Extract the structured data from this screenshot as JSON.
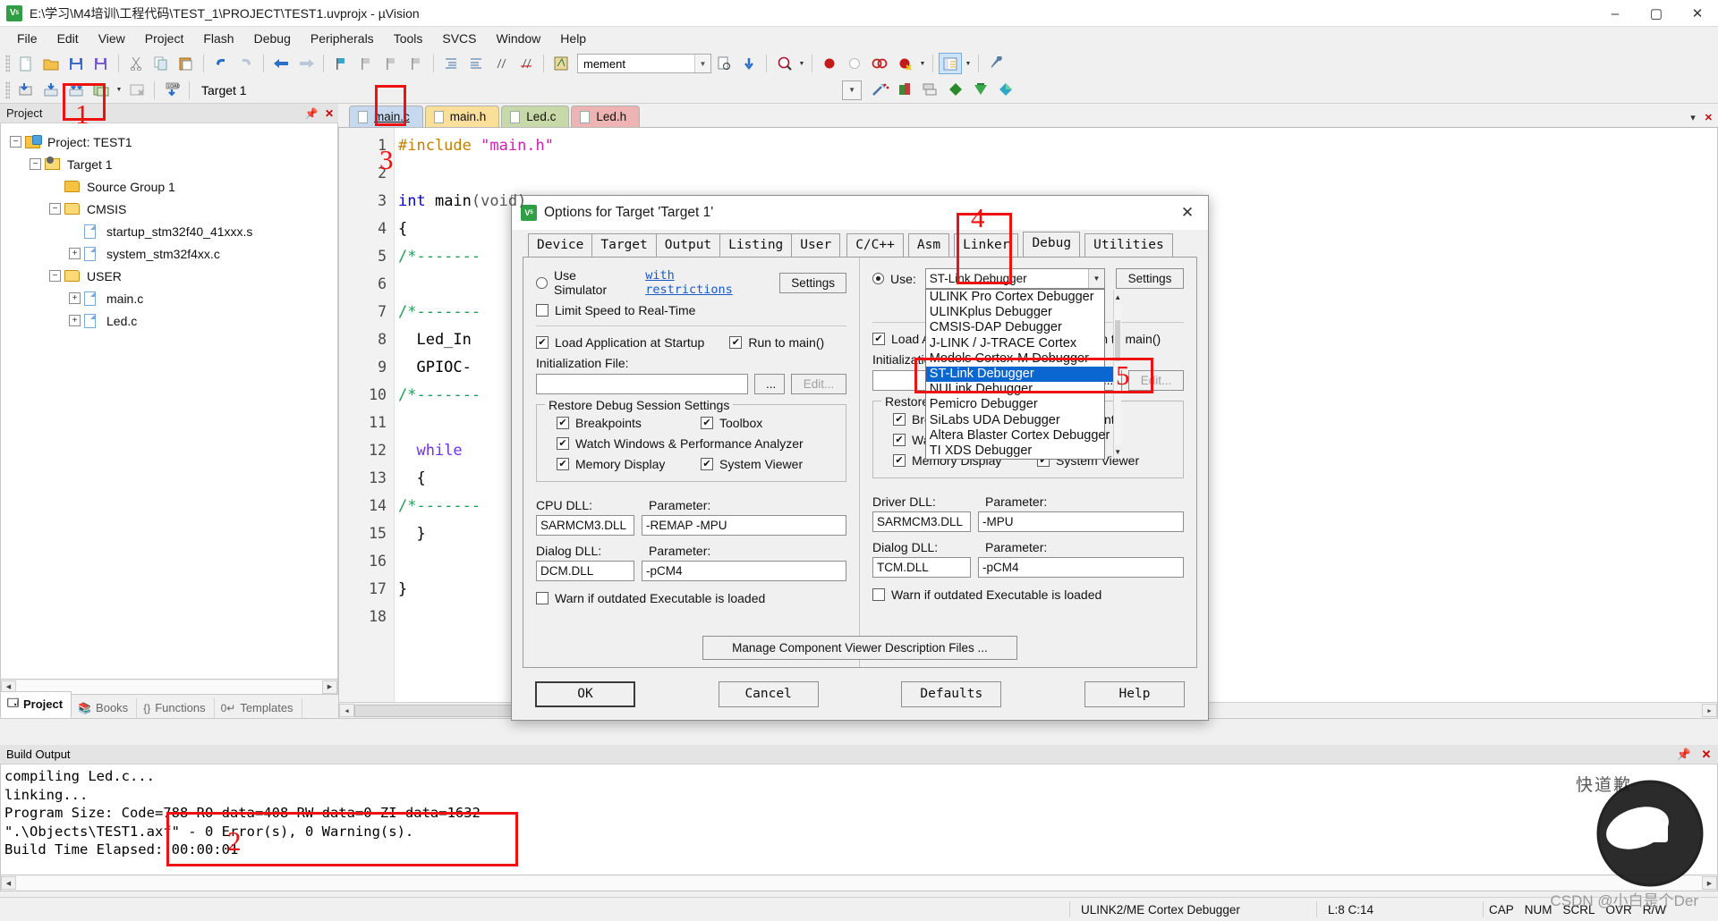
{
  "window": {
    "title": "E:\\学习\\M4培训\\工程代码\\TEST_1\\PROJECT\\TEST1.uvprojx - µVision",
    "app_icon": "uvision-icon",
    "minimize": "–",
    "maximize": "▢",
    "close": "✕"
  },
  "menubar": {
    "items": [
      "File",
      "Edit",
      "View",
      "Project",
      "Flash",
      "Debug",
      "Peripherals",
      "Tools",
      "SVCS",
      "Window",
      "Help"
    ]
  },
  "toolbar2": {
    "target_label": "Target 1",
    "combo_value": "mement"
  },
  "project": {
    "pane_title": "Project",
    "tabs": [
      {
        "label": "Project",
        "icon": "project-icon",
        "selected": true
      },
      {
        "label": "Books",
        "icon": "books-icon",
        "selected": false
      },
      {
        "label": "Functions",
        "icon": "functions-icon",
        "selected": false
      },
      {
        "label": "Templates",
        "icon": "templates-icon",
        "selected": false
      }
    ],
    "tree": [
      {
        "label": "Project: TEST1",
        "depth": 0,
        "expander": "−",
        "icon": "project-icon"
      },
      {
        "label": "Target 1",
        "depth": 1,
        "expander": "−",
        "icon": "target-icon"
      },
      {
        "label": "Source Group 1",
        "depth": 2,
        "expander": "",
        "icon": "folder-icon"
      },
      {
        "label": "CMSIS",
        "depth": 2,
        "expander": "−",
        "icon": "folder-icon"
      },
      {
        "label": "startup_stm32f40_41xxx.s",
        "depth": 3,
        "expander": "",
        "icon": "file-icon"
      },
      {
        "label": "system_stm32f4xx.c",
        "depth": 3,
        "expander": "+",
        "icon": "file-icon"
      },
      {
        "label": "USER",
        "depth": 2,
        "expander": "−",
        "icon": "folder-icon"
      },
      {
        "label": "main.c",
        "depth": 3,
        "expander": "+",
        "icon": "file-icon"
      },
      {
        "label": "Led.c",
        "depth": 3,
        "expander": "+",
        "icon": "file-icon"
      }
    ]
  },
  "editor": {
    "tabs": [
      {
        "label": "main.c",
        "selected": true,
        "color": "#c6d9ef"
      },
      {
        "label": "main.h",
        "selected": false,
        "color": "#fadf9a"
      },
      {
        "label": "Led.c",
        "selected": false,
        "color": "#c7d9a8"
      },
      {
        "label": "Led.h",
        "selected": false,
        "color": "#eeb4b4"
      }
    ],
    "lines": [
      {
        "no": "1",
        "segments": [
          {
            "t": "#include ",
            "c": "pre"
          },
          {
            "t": "\"main.h\"",
            "c": "str"
          }
        ]
      },
      {
        "no": "2",
        "segments": []
      },
      {
        "no": "3",
        "segments": [
          {
            "t": "int ",
            "c": "kw"
          },
          {
            "t": "main",
            "c": "plain"
          },
          {
            "t": "(void)",
            "c": "plain"
          }
        ]
      },
      {
        "no": "4",
        "segments": [
          {
            "t": "{",
            "c": "plain"
          }
        ]
      },
      {
        "no": "5",
        "segments": [
          {
            "t": "/*-------",
            "c": "cmt"
          }
        ]
      },
      {
        "no": "6",
        "segments": []
      },
      {
        "no": "7",
        "segments": [
          {
            "t": "/*-------",
            "c": "cmt"
          }
        ]
      },
      {
        "no": "8",
        "segments": [
          {
            "t": "  Led_In",
            "c": "plain"
          }
        ]
      },
      {
        "no": "9",
        "segments": [
          {
            "t": "  GPIOC-",
            "c": "plain"
          }
        ]
      },
      {
        "no": "10",
        "segments": [
          {
            "t": "/*-------",
            "c": "cmt"
          }
        ]
      },
      {
        "no": "11",
        "segments": []
      },
      {
        "no": "12",
        "segments": [
          {
            "t": "  while",
            "c": "kw2"
          }
        ]
      },
      {
        "no": "13",
        "segments": [
          {
            "t": "  {",
            "c": "plain"
          }
        ]
      },
      {
        "no": "14",
        "segments": [
          {
            "t": "/*-------",
            "c": "cmt"
          }
        ]
      },
      {
        "no": "15",
        "segments": [
          {
            "t": "  }",
            "c": "plain"
          }
        ]
      },
      {
        "no": "16",
        "segments": []
      },
      {
        "no": "17",
        "segments": [
          {
            "t": "}",
            "c": "plain"
          }
        ]
      },
      {
        "no": "18",
        "segments": []
      }
    ]
  },
  "build_output": {
    "title": "Build Output",
    "lines": [
      "compiling Led.c...",
      "linking...",
      "Program Size: Code=788 RO-data=408 RW-data=0 ZI-data=1632",
      "\".\\Objects\\TEST1.axf\" - 0 Error(s), 0 Warning(s).",
      "Build Time Elapsed:  00:00:01"
    ]
  },
  "statusbar": {
    "debugger": "ULINK2/ME Cortex Debugger",
    "cursor": "L:8 C:14",
    "indicators": [
      "CAP",
      "NUM",
      "SCRL",
      "OVR",
      "R/W"
    ]
  },
  "dialog": {
    "title": "Options for Target 'Target 1'",
    "close": "✕",
    "tabs": [
      {
        "label": "Device",
        "selected": false
      },
      {
        "label": "Target",
        "selected": false
      },
      {
        "label": "Output",
        "selected": false
      },
      {
        "label": "Listing",
        "selected": false
      },
      {
        "label": "User",
        "selected": false
      },
      {
        "label": "C/C++",
        "selected": false
      },
      {
        "label": "Asm",
        "selected": false
      },
      {
        "label": "Linker",
        "selected": false
      },
      {
        "label": "Debug",
        "selected": true
      },
      {
        "label": "Utilities",
        "selected": false
      }
    ],
    "left": {
      "use_simulator": "Use Simulator",
      "use_simulator_checked": false,
      "with_restrictions": "with restrictions",
      "settings_button": "Settings",
      "limit_speed": "Limit Speed to Real-Time",
      "limit_speed_checked": false,
      "load_app": "Load Application at Startup",
      "load_app_checked": true,
      "run_to_main": "Run to main()",
      "run_to_main_checked": true,
      "init_file_label": "Initialization File:",
      "init_file_value": "",
      "browse_button": "...",
      "edit_button": "Edit...",
      "restore_group": "Restore Debug Session Settings",
      "restore_items": [
        {
          "label": "Breakpoints",
          "checked": true
        },
        {
          "label": "Toolbox",
          "checked": true
        },
        {
          "label": "Watch Windows & Performance Analyzer",
          "checked": true
        },
        {
          "label": "Memory Display",
          "checked": true
        },
        {
          "label": "System Viewer",
          "checked": true
        }
      ],
      "cpu_dll_label": "CPU DLL:",
      "cpu_dll_value": "SARMCM3.DLL",
      "cpu_param_label": "Parameter:",
      "cpu_param_value": "-REMAP -MPU",
      "dialog_dll_label": "Dialog DLL:",
      "dialog_dll_value": "DCM.DLL",
      "dialog_param_label": "Parameter:",
      "dialog_param_value": "-pCM4",
      "warn_outdated": "Warn if outdated Executable is loaded",
      "warn_outdated_checked": false
    },
    "right": {
      "use_label": "Use:",
      "use_checked": true,
      "selected_debugger": "ST-Link Debugger",
      "settings_button": "Settings",
      "debugger_options": [
        "ULINK Pro Cortex Debugger",
        "ULINKplus Debugger",
        "CMSIS-DAP Debugger",
        "J-LINK / J-TRACE Cortex",
        "Models Cortex-M Debugger",
        "ST-Link Debugger",
        "NULink Debugger",
        "Pemicro Debugger",
        "SiLabs UDA Debugger",
        "Altera Blaster Cortex Debugger",
        "TI XDS Debugger"
      ],
      "selected_option_index": 5,
      "load_app": "Load Application at Startup",
      "load_app_checked": true,
      "run_to_main": "Run to main()",
      "run_to_main_checked": true,
      "init_file_label": "Initialization File:",
      "init_file_value": "",
      "browse_button": "...",
      "edit_button": "Edit...",
      "restore_group": "Restore Debug Session Settings",
      "restore_items": [
        {
          "label": "Breakpoints",
          "checked": true
        },
        {
          "label": "Tracepoints",
          "checked": true
        },
        {
          "label": "Watch Windows",
          "checked": true
        },
        {
          "label": "Memory Display",
          "checked": true
        },
        {
          "label": "System Viewer",
          "checked": true
        }
      ],
      "driver_dll_label": "Driver DLL:",
      "driver_dll_value": "SARMCM3.DLL",
      "driver_param_label": "Parameter:",
      "driver_param_value": "-MPU",
      "dialog_dll_label": "Dialog DLL:",
      "dialog_dll_value": "TCM.DLL",
      "dialog_param_label": "Parameter:",
      "dialog_param_value": "-pCM4",
      "warn_outdated": "Warn if outdated Executable is loaded",
      "warn_outdated_checked": false
    },
    "manage_button": "Manage Component Viewer Description Files ...",
    "buttons": {
      "ok": "OK",
      "cancel": "Cancel",
      "defaults": "Defaults",
      "help": "Help"
    }
  },
  "annotations": {
    "marks": [
      "1",
      "2",
      "3",
      "4",
      "5"
    ],
    "color": "#ee1111"
  },
  "watermark": {
    "cn_text": "快道歉",
    "csdn_text": "CSDN @小白是个Der"
  }
}
